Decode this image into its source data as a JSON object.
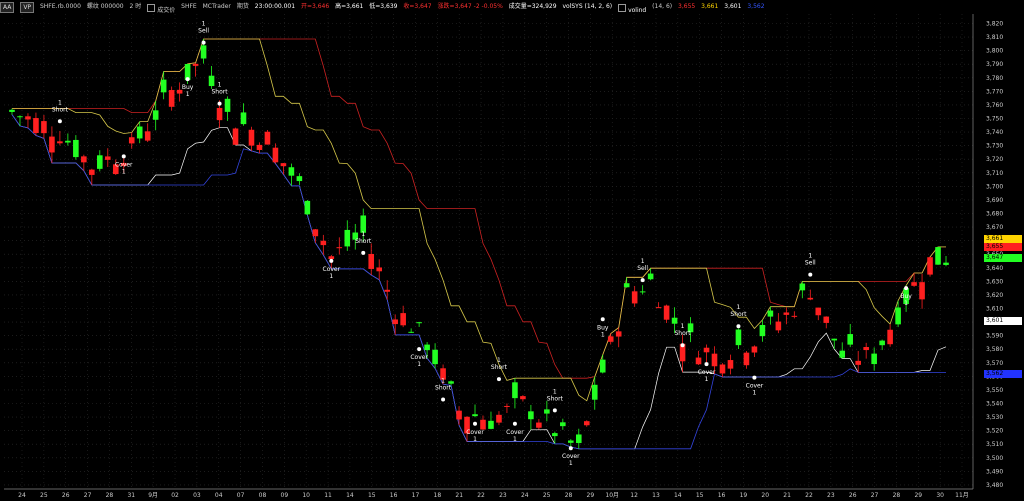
{
  "toolbar": {
    "main_btn": "AA",
    "vip_label": "VP",
    "symbol": "SHFE.rb.0000",
    "contract": "螺纹 000000",
    "period": "2 时",
    "chk1": "成交价",
    "chk2": "SHFE",
    "chk3": "MCTrader",
    "chk4": "期货",
    "time": "23:00:00.001",
    "open": "开=3,646",
    "high": "高=3,661",
    "low": "低=3,639",
    "close": "收=3,647",
    "change": "涨跌=3,647 -2 -0.05%",
    "volume": "成交量=324,929",
    "ind1": "volSYS (14, 2, 6)",
    "ind2": "volind",
    "ind2_params": "(14, 6)",
    "v1": "3,655",
    "v2": "3,661",
    "v3": "3,601",
    "v4": "3,562"
  },
  "colors": {
    "up": "#ff2020",
    "down": "#22ff22",
    "upper": "#cc2222",
    "mid": "#d6c84a",
    "lower": "#3344dd",
    "white": "#ffffff"
  },
  "price_tags": [
    {
      "text": "3,661",
      "bg": "#ffd400",
      "price": 3661
    },
    {
      "text": "3,655",
      "bg": "#ff2020",
      "price": 3655
    },
    {
      "text": "3,647",
      "bg": "#22ff22",
      "price": 3647
    },
    {
      "text": "3,601",
      "bg": "#ffffff",
      "price": 3601
    },
    {
      "text": "3,562",
      "bg": "#2233ff",
      "price": 3562
    }
  ],
  "chart_data": {
    "type": "candlestick",
    "y_ticks": [
      "3,480",
      "3,490",
      "3,500",
      "3,510",
      "3,520",
      "3,530",
      "3,540",
      "3,550",
      "3,560",
      "3,570",
      "3,580",
      "3,590",
      "3,600",
      "3,610",
      "3,620",
      "3,630",
      "3,640",
      "3,650",
      "3,660",
      "3,670",
      "3,680",
      "3,690",
      "3,700",
      "3,710",
      "3,720",
      "3,730",
      "3,740",
      "3,750",
      "3,760",
      "3,770",
      "3,780",
      "3,790",
      "3,800",
      "3,810",
      "3,820"
    ],
    "ylim": [
      3477,
      3827
    ],
    "x_labels": [
      "24",
      "25",
      "26",
      "27",
      "28",
      "31",
      "9月",
      "02",
      "03",
      "04",
      "07",
      "08",
      "09",
      "10",
      "11",
      "14",
      "15",
      "16",
      "17",
      "18",
      "21",
      "22",
      "23",
      "24",
      "25",
      "28",
      "29",
      "10月",
      "12",
      "13",
      "14",
      "15",
      "16",
      "19",
      "20",
      "21",
      "22",
      "23",
      "26",
      "27",
      "28",
      "29",
      "30",
      "11月"
    ],
    "signals": [
      {
        "label": "Short",
        "qty": "1",
        "bar": 6,
        "price": 3745,
        "side": "above"
      },
      {
        "label": "Cover",
        "qty": "1",
        "bar": 14,
        "price": 3725,
        "side": "below"
      },
      {
        "label": "Sell",
        "qty": "1",
        "bar": 24,
        "price": 3803,
        "side": "above"
      },
      {
        "label": "Buy",
        "qty": "1",
        "bar": 22,
        "price": 3782,
        "side": "below"
      },
      {
        "label": "Short",
        "qty": "1",
        "bar": 26,
        "price": 3758,
        "side": "above"
      },
      {
        "label": "Cover",
        "qty": "1",
        "bar": 40,
        "price": 3648,
        "side": "below"
      },
      {
        "label": "Short",
        "qty": "1",
        "bar": 44,
        "price": 3648,
        "side": "above"
      },
      {
        "label": "Cover",
        "qty": "1",
        "bar": 51,
        "price": 3583,
        "side": "below"
      },
      {
        "label": "Short",
        "qty": "1",
        "bar": 54,
        "price": 3540,
        "side": "above"
      },
      {
        "label": "Cover",
        "qty": "1",
        "bar": 58,
        "price": 3528,
        "side": "below"
      },
      {
        "label": "Short",
        "qty": "1",
        "bar": 61,
        "price": 3555,
        "side": "above"
      },
      {
        "label": "Cover",
        "qty": "1",
        "bar": 63,
        "price": 3528,
        "side": "below"
      },
      {
        "label": "Short",
        "qty": "1",
        "bar": 68,
        "price": 3532,
        "side": "above"
      },
      {
        "label": "Cover",
        "qty": "1",
        "bar": 70,
        "price": 3510,
        "side": "below"
      },
      {
        "label": "Buy",
        "qty": "1",
        "bar": 74,
        "price": 3605,
        "side": "below"
      },
      {
        "label": "Sell",
        "qty": "1",
        "bar": 79,
        "price": 3628,
        "side": "above"
      },
      {
        "label": "Short",
        "qty": "1",
        "bar": 84,
        "price": 3580,
        "side": "above"
      },
      {
        "label": "Cover",
        "qty": "1",
        "bar": 87,
        "price": 3572,
        "side": "below"
      },
      {
        "label": "Short",
        "qty": "1",
        "bar": 91,
        "price": 3594,
        "side": "above"
      },
      {
        "label": "Cover",
        "qty": "1",
        "bar": 93,
        "price": 3562,
        "side": "below"
      },
      {
        "label": "Sell",
        "qty": "1",
        "bar": 100,
        "price": 3632,
        "side": "above"
      },
      {
        "label": "Buy",
        "qty": "1",
        "bar": 112,
        "price": 3628,
        "side": "below"
      }
    ]
  }
}
